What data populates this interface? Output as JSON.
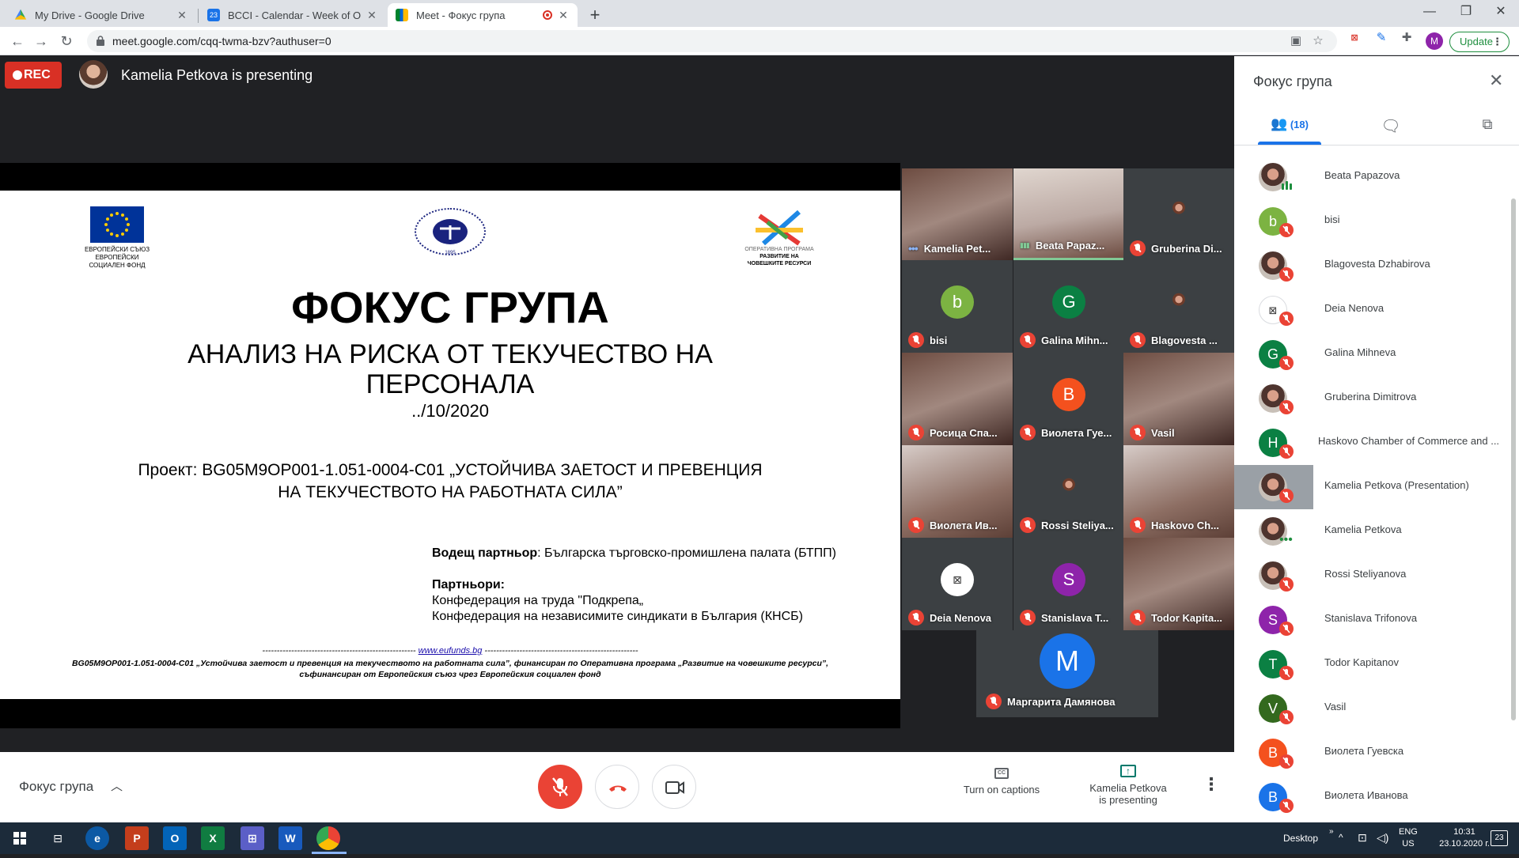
{
  "browser": {
    "tabs": [
      {
        "title": "My Drive - Google Drive",
        "icon": "google-drive-icon"
      },
      {
        "title": "BCCI - Calendar - Week of Octob",
        "icon": "google-calendar-icon"
      },
      {
        "title": "Meet - Фокус група",
        "icon": "google-meet-icon"
      }
    ],
    "url": "meet.google.com/cqq-twma-bzv?authuser=0",
    "profile_initial": "M",
    "update_label": "Update"
  },
  "meet": {
    "rec_label": "REC",
    "presenting_text": "Kamelia Petkova is presenting",
    "meeting_name": "Фокус група",
    "captions_label": "Turn on captions",
    "present_label_1": "Kamelia Petkova",
    "present_label_2": "is presenting",
    "colors": {
      "end_call": "#ea4335",
      "mic_off": "#ea4335",
      "accent": "#1a73e8"
    }
  },
  "slide": {
    "eu_logo_text_1": "ЕВРОПЕЙСКИ СЪЮЗ",
    "eu_logo_text_2": "ЕВРОПЕЙСКИ",
    "eu_logo_text_3": "СОЦИАЛЕН ФОНД",
    "bcci_year": "1895",
    "op_logo_text_1": "ОПЕРАТИВНА ПРОГРАМА",
    "op_logo_text_2": "РАЗВИТИЕ НА",
    "op_logo_text_3": "ЧОВЕШКИТЕ РЕСУРСИ",
    "title": "ФОКУС ГРУПА",
    "subtitle_1": "АНАЛИЗ НА РИСКА ОТ ТЕКУЧЕСТВО НА",
    "subtitle_2": "ПЕРСОНАЛА",
    "date": "../10/2020",
    "project_1": "Проект: BG05M9OP001-1.051-0004-C01 „УСТОЙЧИВА ЗАЕТОСТ И ПРЕВЕНЦИЯ",
    "project_2": "НА ТЕКУЧЕСТВОТО НА РАБОТНАТА СИЛА”",
    "lead_label": "Водещ партньор",
    "lead_value": ": Българска търговско-промишлена палата (БТПП)",
    "partners_label": "Партньори:",
    "partner_1": "Конфедерация на труда \"Подкрепа„",
    "partner_2": "Конфедерация на независимите синдикати в България (КНСБ)",
    "footer_link": "www.eufunds.bg",
    "footer_dashes": "-----------------------------------------------------",
    "footer_1": "BG05M9OP001-1.051-0004-C01 „Устойчива заетост и превенция на текучеството на работната сила”, финансиран по Оперативна програма „Развитие на човешките ресурси”,",
    "footer_2": "съфинансиран от Европейския съюз чрез Европейския социален фонд"
  },
  "tiles": [
    {
      "name": "Kamelia Pet...",
      "state": "speaking-dots",
      "kind": "video"
    },
    {
      "name": "Beata Papaz...",
      "state": "active",
      "kind": "video"
    },
    {
      "name": "Gruberina Di...",
      "state": "muted",
      "kind": "photo"
    },
    {
      "name": "bisi",
      "state": "muted",
      "initial": "b",
      "color": "#7cb342"
    },
    {
      "name": "Galina Mihn...",
      "state": "muted",
      "initial": "G",
      "color": "#0b8043"
    },
    {
      "name": "Blagovesta ...",
      "state": "muted",
      "kind": "photo"
    },
    {
      "name": "Росица Спа...",
      "state": "muted",
      "kind": "video"
    },
    {
      "name": "Виолета Гуе...",
      "state": "muted",
      "initial": "B",
      "color": "#f4511e"
    },
    {
      "name": "Vasil",
      "state": "muted",
      "kind": "video"
    },
    {
      "name": "Виолета Ив...",
      "state": "muted",
      "kind": "video"
    },
    {
      "name": "Rossi Steliya...",
      "state": "muted",
      "kind": "photo"
    },
    {
      "name": "Haskovo Ch...",
      "state": "muted",
      "kind": "video"
    },
    {
      "name": "Deia Nenova",
      "state": "muted",
      "kind": "logo"
    },
    {
      "name": "Stanislava T...",
      "state": "muted",
      "initial": "S",
      "color": "#8e24aa"
    },
    {
      "name": "Todor Kapita...",
      "state": "muted",
      "kind": "video"
    },
    {
      "name": "Маргарита Дамянова",
      "state": "muted",
      "initial": "M",
      "color": "#1a73e8"
    }
  ],
  "panel": {
    "title": "Фокус група",
    "people_count": "(18)",
    "people": [
      {
        "name": "Beata Papazova",
        "state": "speaking",
        "kind": "photo"
      },
      {
        "name": "bisi",
        "state": "muted",
        "initial": "b",
        "color": "#7cb342"
      },
      {
        "name": "Blagovesta Dzhabirova",
        "state": "muted",
        "kind": "photo"
      },
      {
        "name": "Deia Nenova",
        "state": "muted",
        "kind": "logo"
      },
      {
        "name": "Galina Mihneva",
        "state": "muted",
        "initial": "G",
        "color": "#0b8043"
      },
      {
        "name": "Gruberina Dimitrova",
        "state": "muted",
        "kind": "photo"
      },
      {
        "name": "Haskovo Chamber of Commerce and ...",
        "state": "muted",
        "initial": "H",
        "color": "#0b8043"
      },
      {
        "name": "Kamelia Petkova (Presentation)",
        "state": "muted",
        "kind": "photo",
        "highlight": true
      },
      {
        "name": "Kamelia Petkova",
        "state": "dots",
        "kind": "photo"
      },
      {
        "name": "Rossi Steliyanova",
        "state": "muted",
        "kind": "photo"
      },
      {
        "name": "Stanislava Trifonova",
        "state": "muted",
        "initial": "S",
        "color": "#8e24aa"
      },
      {
        "name": "Todor Kapitanov",
        "state": "muted",
        "initial": "T",
        "color": "#0b8043"
      },
      {
        "name": "Vasil",
        "state": "muted",
        "initial": "V",
        "color": "#33691e"
      },
      {
        "name": "Виолета Гуевска",
        "state": "muted",
        "initial": "B",
        "color": "#f4511e"
      },
      {
        "name": "Виолета Иванова",
        "state": "muted",
        "initial": "B",
        "color": "#1a73e8"
      }
    ]
  },
  "taskbar": {
    "desktop_label": "Desktop",
    "lang_1": "ENG",
    "lang_2": "US",
    "time": "10:31",
    "date": "23.10.2020 г.",
    "notifications": "23",
    "apps": [
      "windows-start-icon",
      "task-view-icon",
      "edge-icon",
      "powerpoint-icon",
      "outlook-icon",
      "excel-icon",
      "store-icon",
      "word-icon",
      "chrome-icon"
    ]
  }
}
